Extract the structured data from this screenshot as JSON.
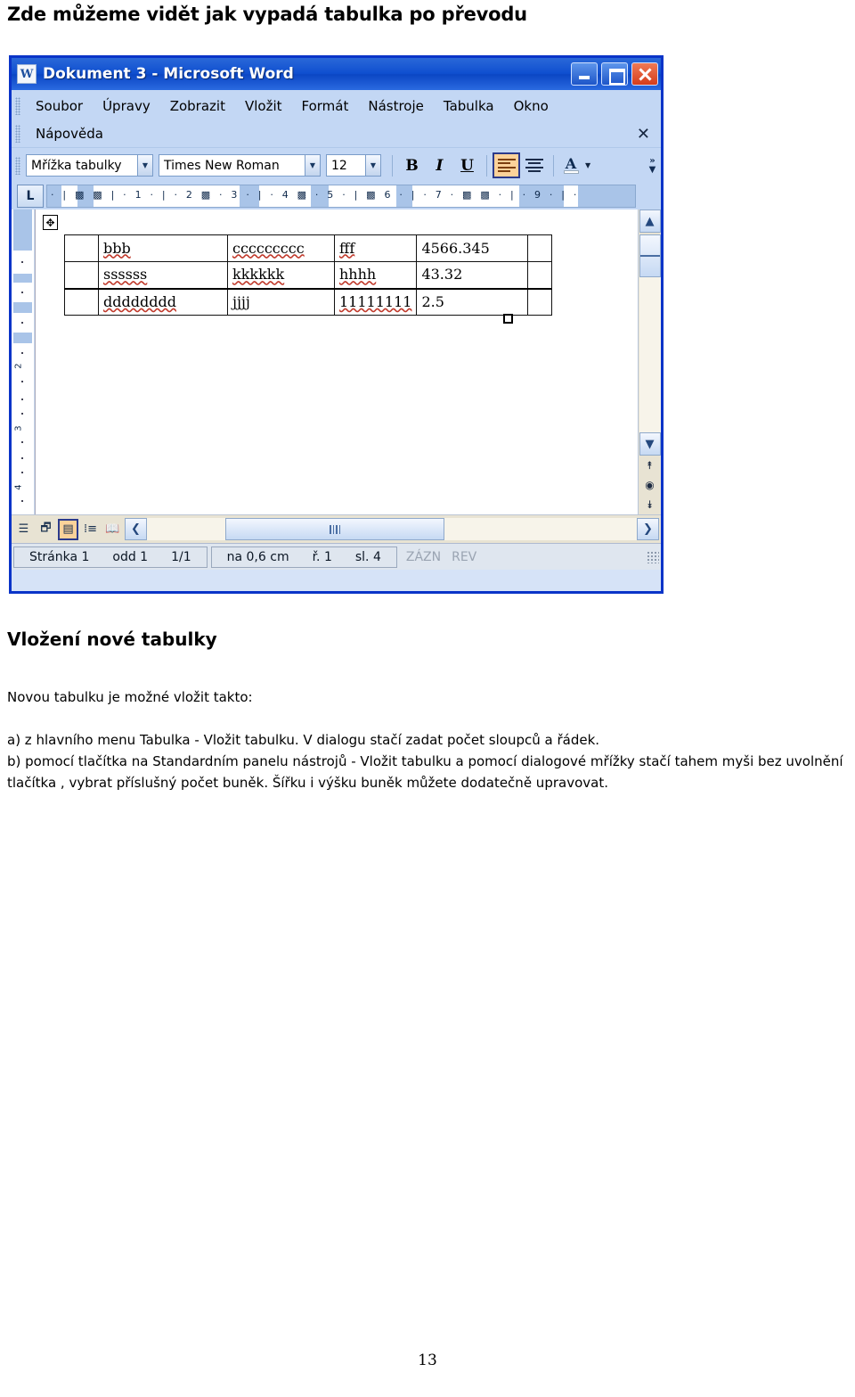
{
  "page": {
    "heading": "Zde můžeme vidět jak vypadá tabulka po převodu",
    "section_title": "Vložení nové tabulky",
    "intro": "Novou tabulku je možné vložit takto:",
    "paragraph_a": "a) z hlavního menu Tabulka - Vložit tabulku. V dialogu stačí zadat počet sloupců a řádek.",
    "paragraph_b": "b) pomocí tlačítka na Standardním panelu nástrojů - Vložit tabulku a pomocí dialogové mřížky stačí tahem myši bez uvolnění tlačítka , vybrat příslušný počet buněk. Šířku i výšku buněk můžete dodatečně upravovat.",
    "page_number": "13"
  },
  "word": {
    "title": "Dokument 3 - Microsoft Word",
    "window_icon": "word-document-icon",
    "window_buttons": {
      "minimize": "minimize-icon",
      "restore": "restore-icon",
      "close": "close-icon"
    },
    "menus_row1": [
      "Soubor",
      "Úpravy",
      "Zobrazit",
      "Vložit",
      "Formát",
      "Nástroje",
      "Tabulka",
      "Okno"
    ],
    "menus_row2": [
      "Nápověda"
    ],
    "menu_close_glyph": "✕",
    "toolbar": {
      "style": "Mřížka tabulky",
      "font": "Times New Roman",
      "size": "12",
      "bold": "B",
      "italic": "I",
      "underline": "U",
      "align_left": "align-left-icon",
      "align_center": "align-center-icon",
      "font_color": "A",
      "overflow": "»"
    },
    "ruler": {
      "tab_selector": "L",
      "h_ticks": "·  |   ▩   ▩   |  ·  1  ·  |  ·  2  ▩ · 3 · | · 4 ▩  · 5 · | ▩ 6 · | · 7 ·  ▩ ▩ · | · 9 · | ·",
      "v_numbers": [
        "2",
        "3",
        "4"
      ]
    },
    "table": {
      "columns": 6,
      "rows": [
        [
          "",
          "bbb",
          "ccccccccc",
          "fff",
          "4566.345",
          ""
        ],
        [
          "",
          "ssssss",
          "kkkkkk",
          "hhhh",
          "43.32",
          ""
        ],
        [
          "",
          "dddddddd",
          "jjjj",
          "11111111",
          "2.5",
          ""
        ]
      ],
      "move_handle": "table-move-handle-icon",
      "resize_handle": "table-resize-handle-icon"
    },
    "view_buttons": [
      "normal-view-icon",
      "web-layout-view-icon",
      "print-layout-view-icon",
      "outline-view-icon",
      "reading-view-icon"
    ],
    "selected_view": 2,
    "statusbar": {
      "page": "Stránka 1",
      "section": "odd 1",
      "pages": "1/1",
      "at": "na 0,6 cm",
      "line": "ř. 1",
      "column": "sl. 4",
      "rec": "ZÁZN",
      "trk": "REV"
    },
    "scroll": {
      "up": "▲",
      "down": "▼",
      "left": "❮",
      "right": "❯",
      "prev_page": "prev-page-icon",
      "select_browse_object": "select-browse-object-icon",
      "next_page": "next-page-icon"
    }
  },
  "colors": {
    "title_gradient_start": "#2a68d8",
    "title_gradient_end": "#0b46c4",
    "window_border": "#0a34c8",
    "toolbar_bg": "#c3d7f4",
    "close_button": "#d53d1b",
    "active_button": "#fcd29a",
    "spell_error": "#c0392b"
  }
}
